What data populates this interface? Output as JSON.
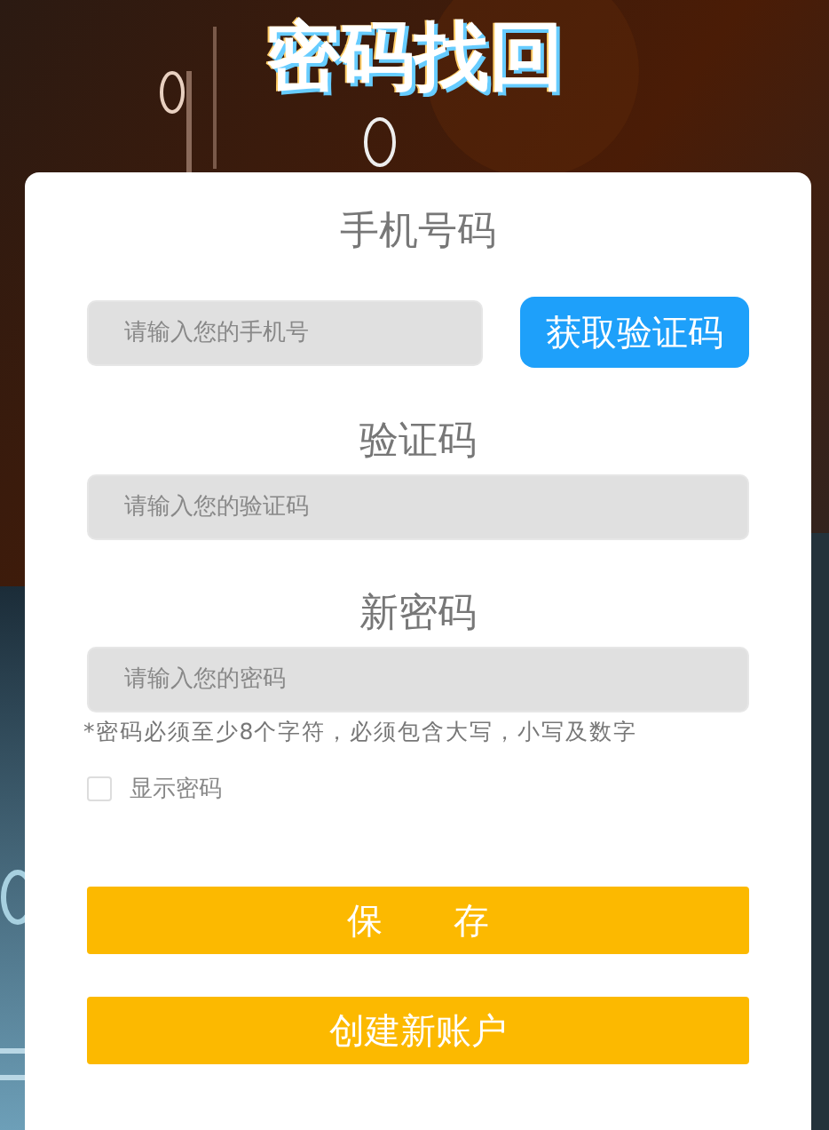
{
  "title": "密码找回",
  "fields": [
    {
      "kind": "phone",
      "label": "手机号码",
      "placeholder": "请输入您的手机号",
      "button": "获取验证码"
    },
    {
      "kind": "plain",
      "label": "验证码",
      "placeholder": "请输入您的验证码"
    },
    {
      "kind": "plain",
      "label": "新密码",
      "placeholder": "请输入您的密码",
      "note": "*密码必须至少8个字符，必须包含大写，小写及数字"
    }
  ],
  "show_password": {
    "label": "显示密码",
    "checked": false
  },
  "buttons": [
    "保　　存",
    "创建新账户"
  ]
}
